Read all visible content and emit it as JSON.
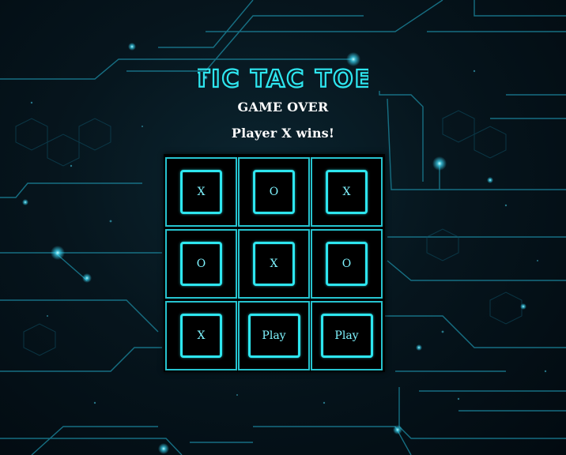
{
  "game": {
    "title": "TIC TAC TOE",
    "status": "GAME OVER",
    "result": "Player X wins!"
  },
  "board": {
    "cells": [
      "X",
      "O",
      "X",
      "O",
      "X",
      "O",
      "X",
      "Play",
      "Play"
    ]
  },
  "colors": {
    "accent": "#2ee6ef",
    "grid": "#26c3cf",
    "text": "#7ff4ff",
    "background": "#020b11"
  }
}
